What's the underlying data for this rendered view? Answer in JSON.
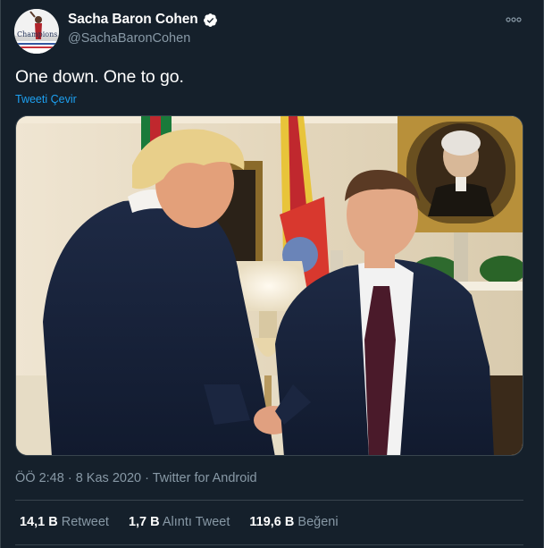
{
  "user": {
    "display_name": "Sacha Baron Cohen",
    "handle": "@SachaBaronCohen",
    "avatar_text": "Champions",
    "verified_icon": "verified-badge-icon"
  },
  "tweet": {
    "text": "One down. One to go.",
    "translate_label": "Tweeti Çevir",
    "media_alt": "photo"
  },
  "meta": {
    "time": "ÖÖ 2:48",
    "date": "8 Kas 2020",
    "separator": "·",
    "source": "Twitter for Android"
  },
  "stats": {
    "retweets": {
      "value": "14,1 B",
      "label": "Retweet"
    },
    "quotes": {
      "value": "1,7 B",
      "label": "Alıntı Tweet"
    },
    "likes": {
      "value": "119,6 B",
      "label": "Beğeni"
    }
  },
  "colors": {
    "background": "#15202b",
    "accent": "#1da1f2",
    "secondary_text": "#8899a6",
    "border": "#38444d"
  }
}
